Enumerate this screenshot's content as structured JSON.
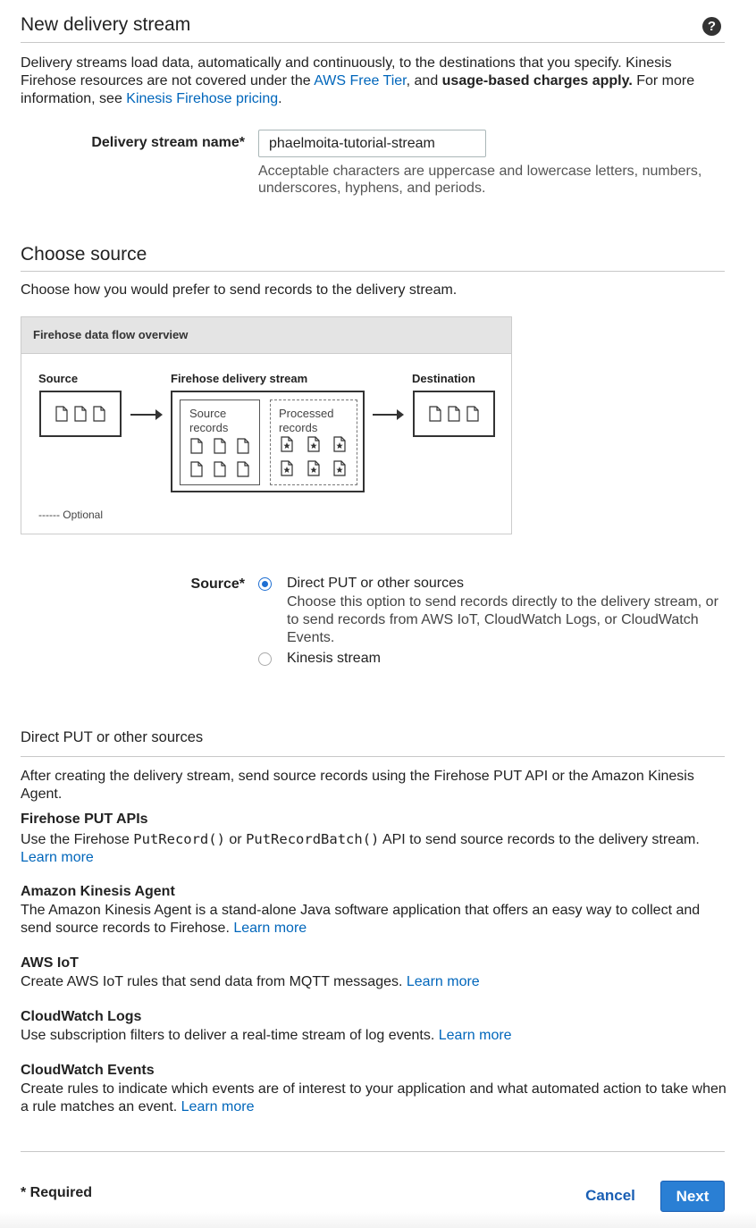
{
  "header": {
    "title": "New delivery stream",
    "help_icon": "help-icon",
    "intro_part1": "Delivery streams load data, automatically and continuously, to the destinations that you specify. Kinesis Firehose resources are not covered under the ",
    "free_tier_link": "AWS Free Tier",
    "intro_part2": ", and ",
    "intro_bold": "usage-based charges apply.",
    "intro_part3": " For more information, see ",
    "pricing_link": "Kinesis Firehose pricing",
    "intro_part4": "."
  },
  "name_field": {
    "label": "Delivery stream name*",
    "value": "phaelmoita-tutorial-stream",
    "hint": "Acceptable characters are uppercase and lowercase letters, numbers, underscores, hyphens, and periods."
  },
  "choose_source": {
    "title": "Choose source",
    "description": "Choose how you would prefer to send records to the delivery stream."
  },
  "diagram": {
    "header": "Firehose data flow overview",
    "source_label": "Source",
    "stream_label": "Firehose delivery stream",
    "destination_label": "Destination",
    "source_records_line1": "Source",
    "source_records_line2": "records",
    "processed_records_line1": "Processed",
    "processed_records_line2": "records",
    "legend": "------ Optional"
  },
  "source_field": {
    "label": "Source*",
    "options": [
      {
        "label": "Direct PUT or other sources",
        "checked": true,
        "description": "Choose this option to send records directly to the delivery stream, or to send records from AWS IoT, CloudWatch Logs, or CloudWatch Events."
      },
      {
        "label": "Kinesis stream",
        "checked": false
      }
    ]
  },
  "direct_put": {
    "title": "Direct PUT or other sources",
    "intro": "After creating the delivery stream, send source records using the Firehose PUT API or the Amazon Kinesis Agent.",
    "learn_more": "Learn more",
    "put_apis": {
      "title": "Firehose PUT APIs",
      "text1": "Use the Firehose ",
      "code1": "PutRecord()",
      "text2": " or ",
      "code2": "PutRecordBatch()",
      "text3": " API to send source records to the delivery stream. "
    },
    "agent": {
      "title": "Amazon Kinesis Agent",
      "text": "The Amazon Kinesis Agent is a stand-alone Java software application that offers an easy way to collect and send source records to Firehose. "
    },
    "iot": {
      "title": "AWS IoT",
      "text": "Create AWS IoT rules that send data from MQTT messages. "
    },
    "logs": {
      "title": "CloudWatch Logs",
      "text": "Use subscription filters to deliver a real-time stream of log events. "
    },
    "events": {
      "title": "CloudWatch Events",
      "text": "Create rules to indicate which events are of interest to your application and what automated action to take when a rule matches an event. "
    }
  },
  "footer": {
    "required": "* Required",
    "cancel": "Cancel",
    "next": "Next"
  }
}
